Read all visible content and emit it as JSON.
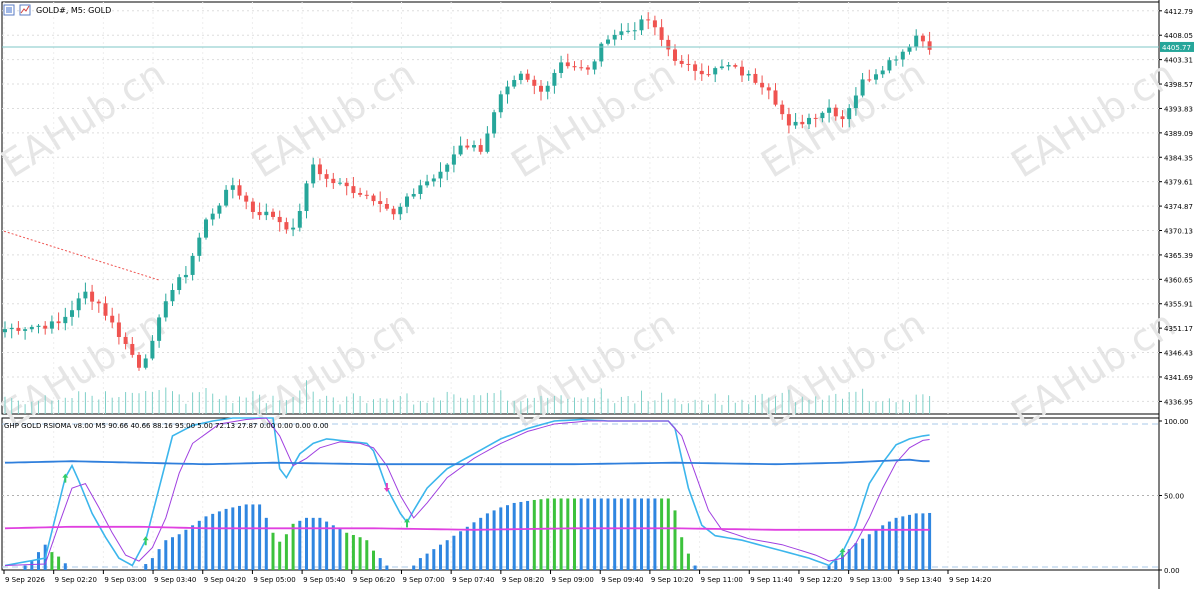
{
  "header": {
    "title": "GOLD#, M5:  GOLD"
  },
  "watermark": {
    "text": "EAHub.cn"
  },
  "indicator": {
    "header": "GHP GOLD RSIOMA v8.00 M5 90.66 40.66 88.16 95.00 5.00 72.13 27.87 0.00 0.00 0.00 0.00"
  },
  "colors": {
    "bull": "#26a69a",
    "bear": "#ef5350",
    "ref_line": "#7fc7c7",
    "rsi_line": "#3cb6ec",
    "signal_line": "#a040e0",
    "level_line": "#2f7fdc",
    "magenta_line": "#e040e0",
    "hist_blue": "#2f86e0",
    "hist_green": "#3cc23c"
  },
  "chart_data": [
    {
      "type": "candlestick",
      "title": "GOLD#, M5: GOLD",
      "ylim": [
        4334.5,
        4414.5
      ],
      "yticks": [
        "4412.79",
        "4408.05",
        "4403.31",
        "4398.57",
        "4393.83",
        "4389.09",
        "4384.35",
        "4379.61",
        "4374.87",
        "4370.13",
        "4365.39",
        "4360.65",
        "4355.91",
        "4351.17",
        "4346.43",
        "4341.69",
        "4336.95"
      ],
      "current_price": "4405.77",
      "x_time_labels": [
        "9 Sep 2026",
        "9 Sep 02:20",
        "9 Sep 03:00",
        "9 Sep 03:40",
        "9 Sep 04:20",
        "9 Sep 05:00",
        "9 Sep 05:40",
        "9 Sep 06:20",
        "9 Sep 07:00",
        "9 Sep 07:40",
        "9 Sep 08:20",
        "9 Sep 09:00",
        "9 Sep 09:40",
        "9 Sep 10:20",
        "9 Sep 11:00",
        "9 Sep 11:40",
        "9 Sep 12:20",
        "9 Sep 13:00",
        "9 Sep 13:40",
        "9 Sep 14:20"
      ],
      "anchors": [
        [
          0,
          4351
        ],
        [
          8,
          4352
        ],
        [
          12,
          4358
        ],
        [
          14,
          4356
        ],
        [
          17,
          4350
        ],
        [
          20,
          4344
        ],
        [
          22,
          4348
        ],
        [
          24,
          4357
        ],
        [
          27,
          4362
        ],
        [
          30,
          4372
        ],
        [
          34,
          4379
        ],
        [
          37,
          4374
        ],
        [
          40,
          4373
        ],
        [
          43,
          4370
        ],
        [
          46,
          4383
        ],
        [
          48,
          4380
        ],
        [
          52,
          4378
        ],
        [
          56,
          4376
        ],
        [
          58,
          4373
        ],
        [
          62,
          4379
        ],
        [
          65,
          4381
        ],
        [
          68,
          4387
        ],
        [
          71,
          4386
        ],
        [
          74,
          4396
        ],
        [
          77,
          4400
        ],
        [
          80,
          4397
        ],
        [
          83,
          4403
        ],
        [
          87,
          4401
        ],
        [
          90,
          4408
        ],
        [
          93,
          4409
        ],
        [
          96,
          4411
        ],
        [
          98,
          4407
        ],
        [
          101,
          4402
        ],
        [
          105,
          4401
        ],
        [
          108,
          4402
        ],
        [
          111,
          4400
        ],
        [
          114,
          4398
        ],
        [
          117,
          4390
        ],
        [
          120,
          4392
        ],
        [
          123,
          4394
        ],
        [
          125,
          4392
        ],
        [
          128,
          4399
        ],
        [
          131,
          4402
        ],
        [
          134,
          4405
        ],
        [
          136,
          4408
        ],
        [
          138,
          4406
        ]
      ],
      "series": [
        "open",
        "high",
        "low",
        "close"
      ]
    },
    {
      "type": "line",
      "title": "GHP GOLD RSIOMA v8.00",
      "ylim": [
        0,
        100
      ],
      "yticks": [
        "100.00",
        "50.00",
        "0.00"
      ],
      "series": [
        {
          "anchors": [
            [
              0,
              3
            ],
            [
              6,
              8
            ],
            [
              9,
              62
            ],
            [
              10,
              70
            ],
            [
              11,
              60
            ],
            [
              13,
              38
            ],
            [
              15,
              22
            ],
            [
              17,
              8
            ],
            [
              19,
              3
            ],
            [
              21,
              20
            ],
            [
              23,
              55
            ],
            [
              25,
              90
            ],
            [
              28,
              97
            ],
            [
              31,
              100
            ],
            [
              34,
              102
            ],
            [
              37,
              104
            ],
            [
              40,
              102
            ],
            [
              41,
              68
            ],
            [
              42,
              62
            ],
            [
              44,
              78
            ],
            [
              46,
              85
            ],
            [
              48,
              88
            ],
            [
              50,
              87
            ],
            [
              52,
              86
            ],
            [
              54,
              85
            ],
            [
              55,
              80
            ],
            [
              57,
              55
            ],
            [
              59,
              38
            ],
            [
              60,
              32
            ],
            [
              61,
              40
            ],
            [
              63,
              55
            ],
            [
              66,
              68
            ],
            [
              70,
              78
            ],
            [
              74,
              88
            ],
            [
              78,
              95
            ],
            [
              82,
              100
            ],
            [
              86,
              101
            ],
            [
              90,
              100
            ],
            [
              95,
              100
            ],
            [
              99,
              100
            ],
            [
              100,
              95
            ],
            [
              102,
              55
            ],
            [
              104,
              30
            ],
            [
              106,
              23
            ],
            [
              110,
              20
            ],
            [
              115,
              14
            ],
            [
              120,
              8
            ],
            [
              123,
              3
            ],
            [
              125,
              12
            ],
            [
              127,
              30
            ],
            [
              129,
              58
            ],
            [
              131,
              72
            ],
            [
              133,
              84
            ],
            [
              135,
              88
            ],
            [
              137,
              90
            ]
          ]
        },
        {
          "anchors": [
            [
              0,
              3
            ],
            [
              6,
              4
            ],
            [
              8,
              30
            ],
            [
              10,
              55
            ],
            [
              12,
              58
            ],
            [
              14,
              42
            ],
            [
              16,
              25
            ],
            [
              18,
              10
            ],
            [
              20,
              6
            ],
            [
              22,
              15
            ],
            [
              24,
              35
            ],
            [
              26,
              65
            ],
            [
              28,
              85
            ],
            [
              32,
              98
            ],
            [
              36,
              101
            ],
            [
              39,
              102
            ],
            [
              41,
              90
            ],
            [
              43,
              70
            ],
            [
              45,
              75
            ],
            [
              47,
              82
            ],
            [
              50,
              86
            ],
            [
              53,
              85
            ],
            [
              55,
              82
            ],
            [
              57,
              70
            ],
            [
              59,
              50
            ],
            [
              61,
              35
            ],
            [
              63,
              45
            ],
            [
              66,
              62
            ],
            [
              70,
              75
            ],
            [
              74,
              85
            ],
            [
              78,
              93
            ],
            [
              82,
              98
            ],
            [
              87,
              100
            ],
            [
              92,
              100
            ],
            [
              99,
              100
            ],
            [
              101,
              90
            ],
            [
              103,
              65
            ],
            [
              105,
              40
            ],
            [
              107,
              27
            ],
            [
              111,
              21
            ],
            [
              116,
              17
            ],
            [
              121,
              10
            ],
            [
              123,
              6
            ],
            [
              125,
              8
            ],
            [
              127,
              18
            ],
            [
              129,
              35
            ],
            [
              131,
              55
            ],
            [
              133,
              72
            ],
            [
              135,
              82
            ],
            [
              137,
              87
            ]
          ]
        },
        {
          "anchors": [
            [
              0,
              72
            ],
            [
              10,
              73
            ],
            [
              20,
              72
            ],
            [
              30,
              71
            ],
            [
              40,
              72
            ],
            [
              55,
              71
            ],
            [
              70,
              71
            ],
            [
              85,
              71
            ],
            [
              100,
              72
            ],
            [
              115,
              71
            ],
            [
              125,
              72
            ],
            [
              130,
              73
            ],
            [
              135,
              74
            ],
            [
              137,
              73
            ]
          ]
        },
        {
          "anchors": [
            [
              0,
              28
            ],
            [
              10,
              29
            ],
            [
              20,
              29
            ],
            [
              30,
              28
            ],
            [
              40,
              28
            ],
            [
              55,
              28
            ],
            [
              70,
              27
            ],
            [
              85,
              28
            ],
            [
              100,
              28
            ],
            [
              115,
              27
            ],
            [
              125,
              27
            ],
            [
              137,
              27
            ]
          ]
        }
      ],
      "histogram": {
        "anchors": [
          [
            0,
            0
          ],
          [
            2,
            0
          ],
          [
            4,
            6
          ],
          [
            5,
            12
          ],
          [
            6,
            17
          ],
          [
            7,
            12
          ],
          [
            8,
            9
          ],
          [
            10,
            0
          ],
          [
            20,
            0
          ],
          [
            22,
            8
          ],
          [
            23,
            14
          ],
          [
            24,
            20
          ],
          [
            26,
            24
          ],
          [
            28,
            30
          ],
          [
            30,
            36
          ],
          [
            33,
            41
          ],
          [
            36,
            44
          ],
          [
            38,
            44
          ],
          [
            39,
            35
          ],
          [
            40,
            25
          ],
          [
            41,
            19
          ],
          [
            42,
            24
          ],
          [
            43,
            31
          ],
          [
            45,
            35
          ],
          [
            47,
            35
          ],
          [
            49,
            30
          ],
          [
            51,
            25
          ],
          [
            53,
            22
          ],
          [
            54,
            20
          ],
          [
            55,
            13
          ],
          [
            56,
            8
          ],
          [
            57,
            3
          ],
          [
            58,
            0
          ],
          [
            60,
            0
          ],
          [
            61,
            3
          ],
          [
            62,
            8
          ],
          [
            64,
            14
          ],
          [
            66,
            20
          ],
          [
            68,
            26
          ],
          [
            70,
            32
          ],
          [
            72,
            38
          ],
          [
            74,
            42
          ],
          [
            76,
            45
          ],
          [
            79,
            47
          ],
          [
            81,
            48
          ],
          [
            99,
            48
          ],
          [
            100,
            40
          ],
          [
            101,
            22
          ],
          [
            102,
            11
          ],
          [
            103,
            3
          ],
          [
            104,
            0
          ],
          [
            122,
            0
          ],
          [
            123,
            3
          ],
          [
            125,
            10
          ],
          [
            127,
            18
          ],
          [
            129,
            24
          ],
          [
            131,
            30
          ],
          [
            133,
            35
          ],
          [
            136,
            38
          ],
          [
            137,
            38
          ]
        ],
        "green": [
          7,
          8,
          40,
          41,
          42,
          43,
          51,
          52,
          53,
          54,
          55,
          79,
          80,
          81,
          82,
          83,
          84,
          85,
          98,
          99,
          100,
          101,
          102
        ]
      },
      "arrows_up": [
        9,
        21,
        60,
        125
      ],
      "arrows_down": [
        57
      ]
    }
  ]
}
